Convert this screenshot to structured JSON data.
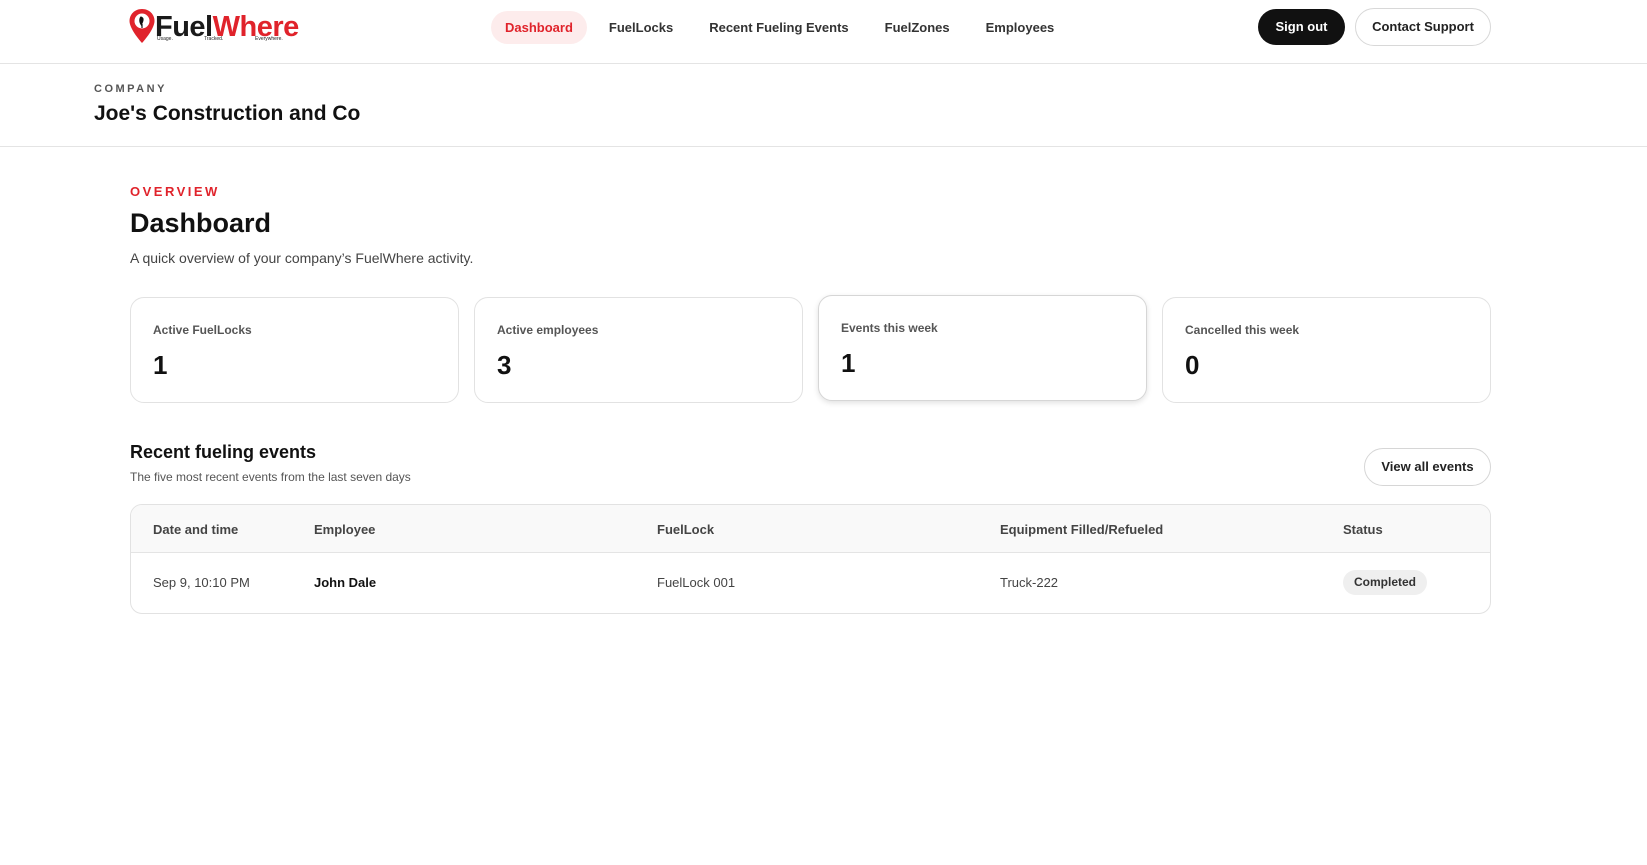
{
  "brand": {
    "name_part1": "Fuel",
    "name_part2": "Where",
    "tagline": [
      "Usage.",
      "Tracked.",
      "Everywhere."
    ],
    "accent_color": "#e0232b"
  },
  "nav": {
    "items": [
      {
        "label": "Dashboard",
        "active": true
      },
      {
        "label": "FuelLocks",
        "active": false
      },
      {
        "label": "Recent Fueling Events",
        "active": false
      },
      {
        "label": "FuelZones",
        "active": false
      },
      {
        "label": "Employees",
        "active": false
      }
    ],
    "sign_out": "Sign out",
    "contact_support": "Contact Support"
  },
  "company": {
    "label": "COMPANY",
    "name": "Joe's Construction and Co"
  },
  "overview": {
    "eyebrow": "OVERVIEW",
    "title": "Dashboard",
    "subtitle": "A quick overview of your company’s FuelWhere activity."
  },
  "stats": [
    {
      "label": "Active FuelLocks",
      "value": "1"
    },
    {
      "label": "Active employees",
      "value": "3"
    },
    {
      "label": "Events this week",
      "value": "1"
    },
    {
      "label": "Cancelled this week",
      "value": "0"
    }
  ],
  "recent_events": {
    "title": "Recent fueling events",
    "subtitle": "The five most recent events from the last seven days",
    "view_all": "View all events",
    "columns": [
      "Date and time",
      "Employee",
      "FuelLock",
      "Equipment Filled/Refueled",
      "Status"
    ],
    "rows": [
      {
        "datetime": "Sep 9, 10:10 PM",
        "employee": "John Dale",
        "fuellock": "FuelLock 001",
        "equipment": "Truck-222",
        "status": "Completed"
      }
    ]
  }
}
